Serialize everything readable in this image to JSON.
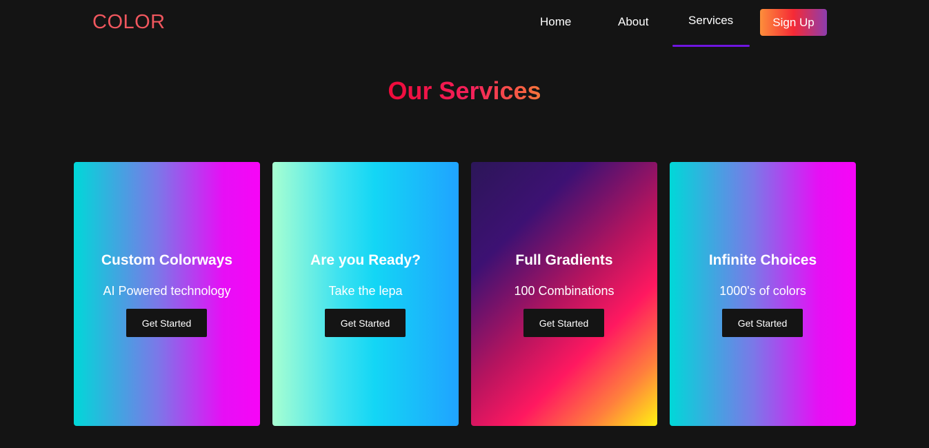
{
  "nav": {
    "logo": "COLOR",
    "links": [
      "Home",
      "About",
      "Services"
    ],
    "active": "Services",
    "signup_label": "Sign Up"
  },
  "page": {
    "title": "Our Services"
  },
  "cards": [
    {
      "title": "Custom Colorways",
      "subtitle": "AI Powered technology",
      "button": "Get Started"
    },
    {
      "title": "Are you Ready?",
      "subtitle": "Take the lepa",
      "button": "Get Started"
    },
    {
      "title": "Full Gradients",
      "subtitle": "100 Combinations",
      "button": "Get Started"
    },
    {
      "title": "Infinite Choices",
      "subtitle": "1000's of colors",
      "button": "Get Started"
    }
  ],
  "colors": {
    "background": "#141414",
    "logo": "#f0575e",
    "active_underline": "#6f15e0"
  }
}
